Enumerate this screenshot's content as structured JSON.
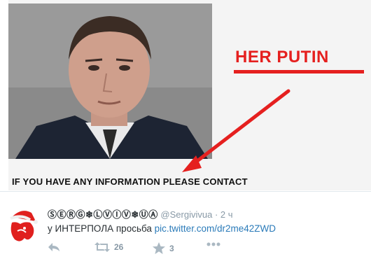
{
  "media": {
    "overlay_text": "HER PUTIN",
    "banner_text": "IF YOU HAVE ANY INFORMATION PLEASE CONTACT",
    "accent_color": "#e5201f"
  },
  "tweet": {
    "display_name": "ⓈⒺⓇⒼ❄ⓁⓋⒾⓋ❄ⓊⒶ",
    "handle": "@Sergivivua",
    "separator": "·",
    "time": "2 ч",
    "text": "у ИНТЕРПОЛА просьба ",
    "link": "pic.twitter.com/dr2me42ZWD",
    "link_color": "#2b7bb9",
    "avatar_icon": "red-lion-santa-hat-icon"
  },
  "actions": {
    "reply_icon": "reply-icon",
    "retweet_icon": "retweet-icon",
    "retweet_count": "26",
    "favorite_icon": "star-icon",
    "favorite_count": "3",
    "more_icon": "more-dots-icon"
  }
}
